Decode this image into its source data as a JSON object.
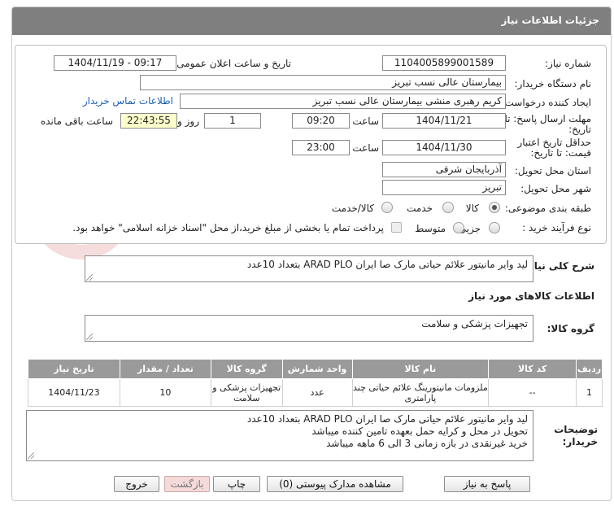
{
  "header": {
    "title": "جزئیات اطلاعات نیاز"
  },
  "form": {
    "need_number_label": "شماره نیاز:",
    "need_number": "1104005899001589",
    "announce_label": "تاریخ و ساعت اعلان عمومی:",
    "announce_value": "1404/11/19 - 09:17",
    "buyer_org_label": "نام دستگاه خریدار:",
    "buyer_org": "بیمارستان عالی نسب تبریز",
    "creator_label": "ایجاد کننده درخواست:",
    "creator": "کریم رهبری منشی بیمارستان عالی نسب تبریز",
    "contact_link": "اطلاعات تماس خریدار",
    "deadline_label_1": "مهلت ارسال پاسخ: تا",
    "deadline_label_2": "تاریخ:",
    "deadline_date": "1404/11/21",
    "hour_label": "ساعت",
    "deadline_time": "09:20",
    "days_value": "1",
    "days_label": "روز و",
    "remaining_time": "22:43:55",
    "remaining_label": "ساعت باقی مانده",
    "validity_label_1": "حداقل تاریخ اعتبار",
    "validity_label_2": "قیمت: تا تاریخ:",
    "validity_date": "1404/11/30",
    "validity_hour_label": "ساعت",
    "validity_time": "23:00",
    "province_label": "استان محل تحویل:",
    "province": "آذربایجان شرقی",
    "city_label": "شهر محل تحویل:",
    "city": "تبریز",
    "category_label": "طبقه بندی موضوعی:",
    "category_options": [
      "کالا",
      "خدمت",
      "کالا/خدمت"
    ],
    "process_label": "نوع فرآیند خرید :",
    "process_options": [
      "جزیی",
      "متوسط"
    ],
    "payment_note": "پرداخت تمام یا بخشی از مبلغ خرید،از محل \"اسناد خزانه اسلامی\" خواهد بود."
  },
  "summary": {
    "label": "شرح کلی نیاز:",
    "text": "لید وایر مانیتور علائم حیاتی  مارک صا ایران ARAD PLO بتعداد 10عدد"
  },
  "goods": {
    "section_title": "اطلاعات کالاهای مورد نیاز",
    "group_label": "گروه کالا:",
    "group_value": "تجهیزات پزشکی و سلامت"
  },
  "table": {
    "headers": [
      "ردیف",
      "کد کالا",
      "نام کالا",
      "واحد شمارش",
      "گروه کالا",
      "تعداد / مقدار",
      "تاریخ نیاز"
    ],
    "rows": [
      [
        "1",
        "--",
        "ملزومات مانیتورینگ علائم حیاتی چند پارامتری",
        "عدد",
        "تجهیزات پزشکی و سلامت",
        "10",
        "1404/11/23"
      ]
    ]
  },
  "buyer_notes": {
    "label_1": "توضیحات",
    "label_2": "خریدار:",
    "text": "لید وایر مانیتور علائم حیاتی  مارک صا ایران ARAD PLO بتعداد 10عدد\nتحویل در محل و کرایه حمل بعهده تامین کننده میباشد\nخرید غیرنقدی در بازه زمانی 3 الی 6 ماهه میباشد"
  },
  "buttons": {
    "reply": "پاسخ به نیاز",
    "docs": "مشاهده مدارک پیوستی (0)",
    "print": "چاپ",
    "back": "بازگشت",
    "exit": "خروج"
  },
  "colors": {
    "header_bg": "#7f7f7f",
    "table_header_bg": "#9a9a9a",
    "remaining_bg": "#ffffcc",
    "link": "#1a5fb4"
  }
}
